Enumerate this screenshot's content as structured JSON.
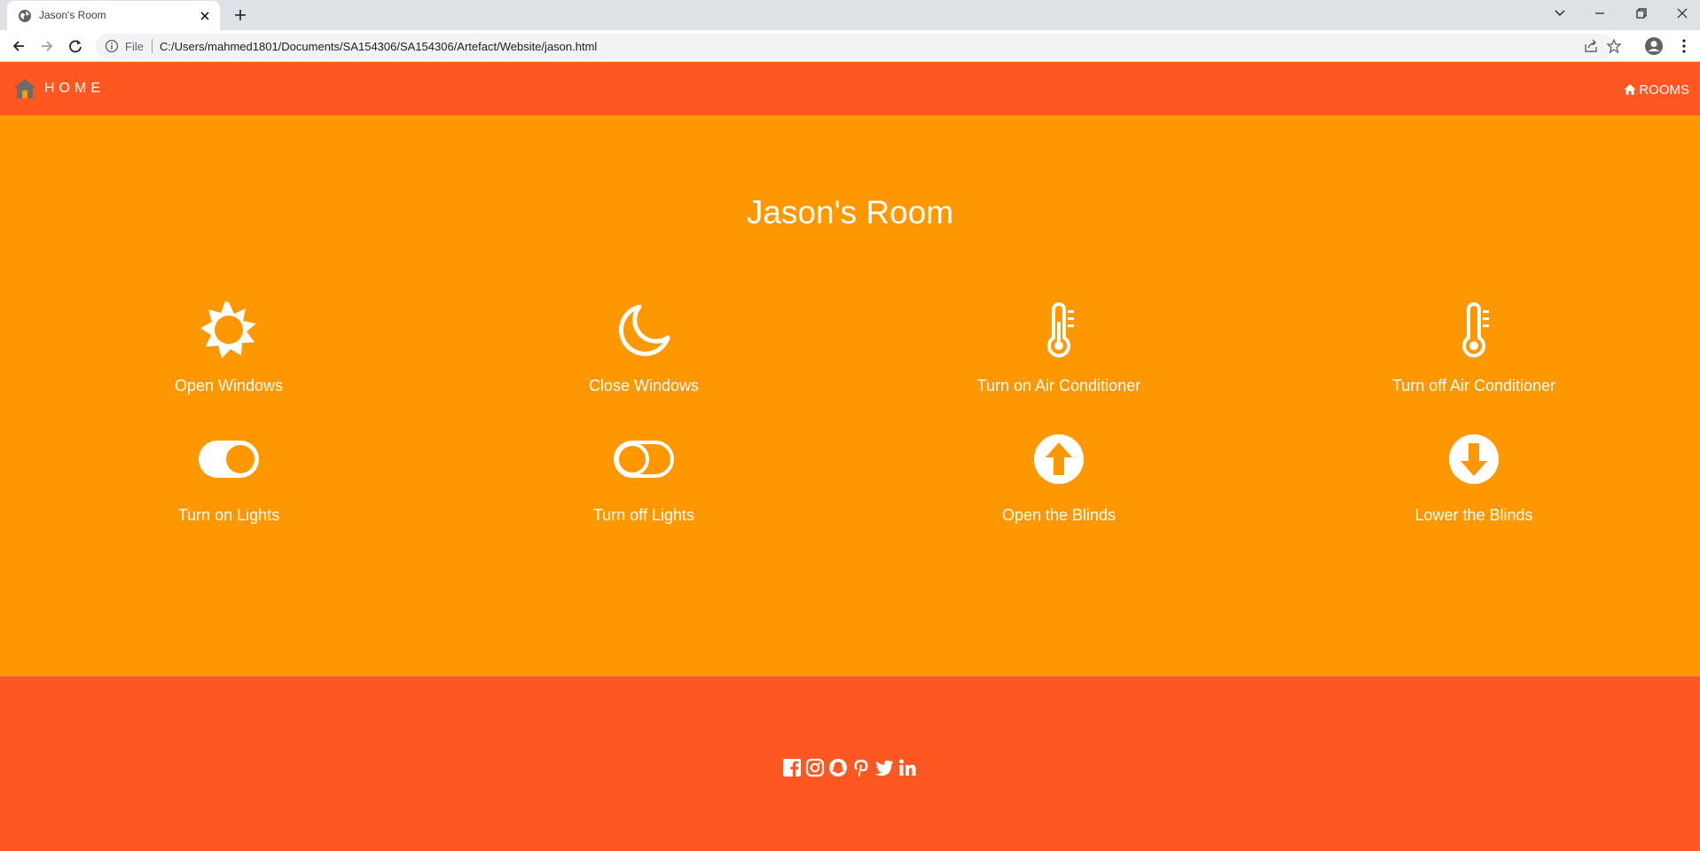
{
  "browser": {
    "tab_title": "Jason's Room",
    "file_label": "File",
    "url": "C:/Users/mahmed1801/Documents/SA154306/SA154306/Artefact/Website/jason.html"
  },
  "nav": {
    "brand": "HOME",
    "rooms": "ROOMS"
  },
  "main": {
    "title": "Jason's Room",
    "controls": [
      {
        "label": "Open Windows",
        "icon": "sun-icon"
      },
      {
        "label": "Close Windows",
        "icon": "moon-icon"
      },
      {
        "label": "Turn on Air Conditioner",
        "icon": "thermometer-icon"
      },
      {
        "label": "Turn off Air Conditioner",
        "icon": "thermometer-icon"
      },
      {
        "label": "Turn on Lights",
        "icon": "toggle-on-icon"
      },
      {
        "label": "Turn off Lights",
        "icon": "toggle-off-icon"
      },
      {
        "label": "Open the Blinds",
        "icon": "arrow-circle-up-icon"
      },
      {
        "label": "Lower the Blinds",
        "icon": "arrow-circle-down-icon"
      }
    ]
  },
  "footer": {
    "social": [
      "facebook-icon",
      "instagram-icon",
      "snapchat-icon",
      "pinterest-icon",
      "twitter-icon",
      "linkedin-icon"
    ]
  },
  "colors": {
    "nav_bg": "#ff5722",
    "main_bg": "#ff9800",
    "text": "#ffffff"
  }
}
